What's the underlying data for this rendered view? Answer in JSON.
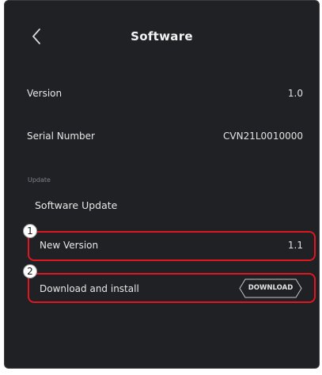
{
  "header": {
    "title": "Software",
    "back_icon": "chevron-left-icon"
  },
  "rows": {
    "version_label": "Version",
    "version_value": "1.0",
    "serial_label": "Serial Number",
    "serial_value": "CVN21L0010000"
  },
  "update": {
    "section_label": "Update",
    "software_update_label": "Software Update",
    "new_version_label": "New Version",
    "new_version_value": "1.1",
    "download_label": "Download and install",
    "download_button": "DOWNLOAD"
  },
  "annotations": {
    "badge_1": "1",
    "badge_2": "2",
    "highlight_color": "#e0171f"
  },
  "colors": {
    "background": "#1f2124",
    "text": "#e7e7e7",
    "muted": "#7e8288"
  }
}
